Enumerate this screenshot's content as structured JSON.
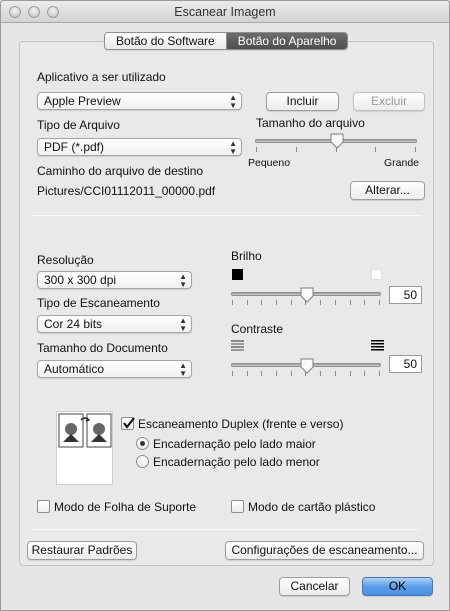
{
  "window": {
    "title": "Escanear Imagem"
  },
  "tabs": [
    "Botão do Software",
    "Botão do Aparelho"
  ],
  "application": {
    "label": "Aplicativo a ser utilizado",
    "selected": "Apple Preview",
    "add_button": "Incluir",
    "remove_button": "Excluir"
  },
  "file_type": {
    "label": "Tipo de Arquivo",
    "selected": "PDF (*.pdf)"
  },
  "file_size": {
    "label": "Tamanho do arquivo",
    "min_label": "Pequeno",
    "max_label": "Grande",
    "level": 0.5
  },
  "destination": {
    "label": "Caminho do arquivo de destino",
    "path": "Pictures/CCI01112011_00000.pdf",
    "change_button": "Alterar..."
  },
  "resolution": {
    "label": "Resolução",
    "selected": "300 x 300 dpi"
  },
  "scan_type": {
    "label": "Tipo de Escaneamento",
    "selected": "Cor 24 bits"
  },
  "document_size": {
    "label": "Tamanho do Documento",
    "selected": "Automático"
  },
  "brightness": {
    "label": "Brilho",
    "value": "50",
    "level": 0.5
  },
  "contrast": {
    "label": "Contraste",
    "value": "50",
    "level": 0.5
  },
  "duplex": {
    "label": "Escaneamento Duplex (frente e verso)",
    "checked": true,
    "options": [
      "Encadernação pelo lado maior",
      "Encadernação pelo lado menor"
    ],
    "selected_index": 0
  },
  "carrier_sheet": {
    "label": "Modo de Folha de Suporte",
    "checked": false
  },
  "plastic_card": {
    "label": "Modo de cartão plástico",
    "checked": false
  },
  "buttons": {
    "restore": "Restaurar Padrões",
    "scan_settings": "Configurações de escaneamento...",
    "cancel": "Cancelar",
    "ok": "OK"
  },
  "colors": {
    "accent": "#4a8fe3",
    "tab_active": "#5a5a5a"
  }
}
